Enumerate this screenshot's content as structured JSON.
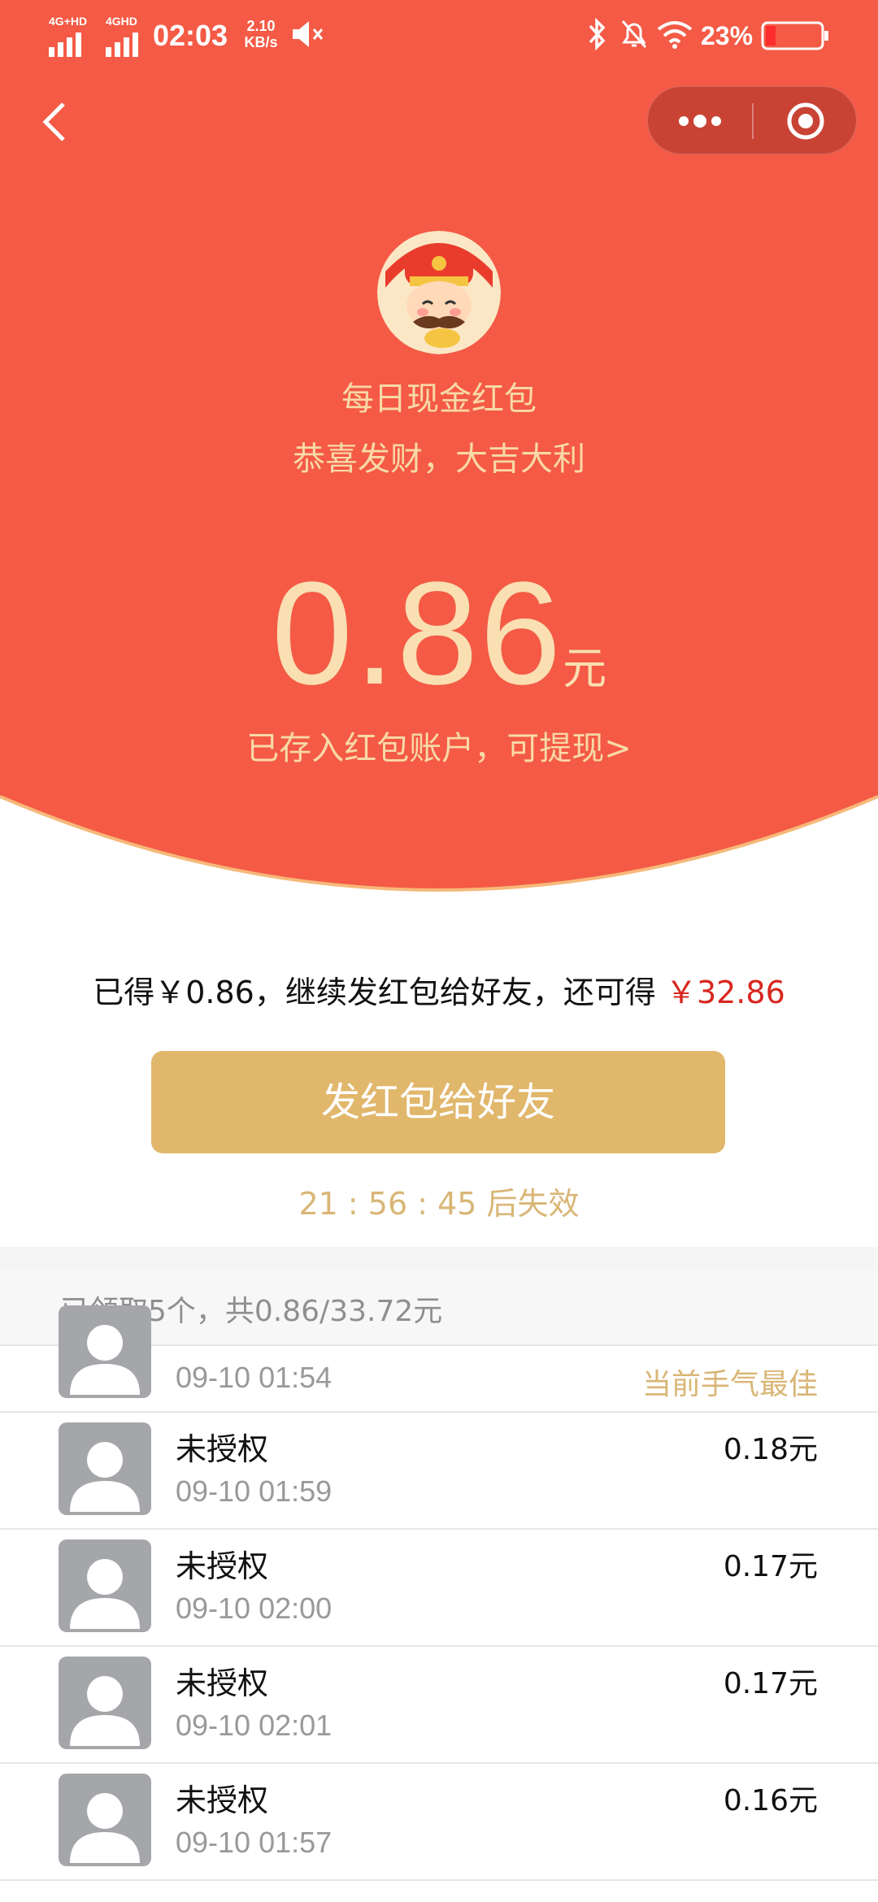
{
  "status_bar": {
    "net1": "4G+HD",
    "net2": "4GHD",
    "time": "02:03",
    "speed_value": "2.10",
    "speed_unit": "KB/s",
    "battery": "23%"
  },
  "header": {
    "title": "每日现金红包",
    "subtitle": "恭喜发财，大吉大利"
  },
  "amount": {
    "value": "0.86",
    "unit": "元",
    "note": "已存入红包账户，可提现>"
  },
  "info": {
    "prefix": "已得￥0.86，继续发红包给好友，还可得",
    "extra": "￥32.86"
  },
  "send_button": "发红包给好友",
  "countdown": "21 : 56 : 45 后失效",
  "summary": "已领取5个，共0.86/33.72元",
  "records": [
    {
      "name": "",
      "time": "09-10 01:54",
      "amount": "",
      "tag": "当前手气最佳"
    },
    {
      "name": "未授权",
      "time": "09-10 01:59",
      "amount": "0.18元",
      "tag": ""
    },
    {
      "name": "未授权",
      "time": "09-10 02:00",
      "amount": "0.17元",
      "tag": ""
    },
    {
      "name": "未授权",
      "time": "09-10 02:01",
      "amount": "0.17元",
      "tag": ""
    },
    {
      "name": "未授权",
      "time": "09-10 01:57",
      "amount": "0.16元",
      "tag": ""
    }
  ],
  "colors": {
    "hero_red": "#f45a45",
    "gold": "#e1b76c",
    "accent_red": "#d8261f"
  }
}
